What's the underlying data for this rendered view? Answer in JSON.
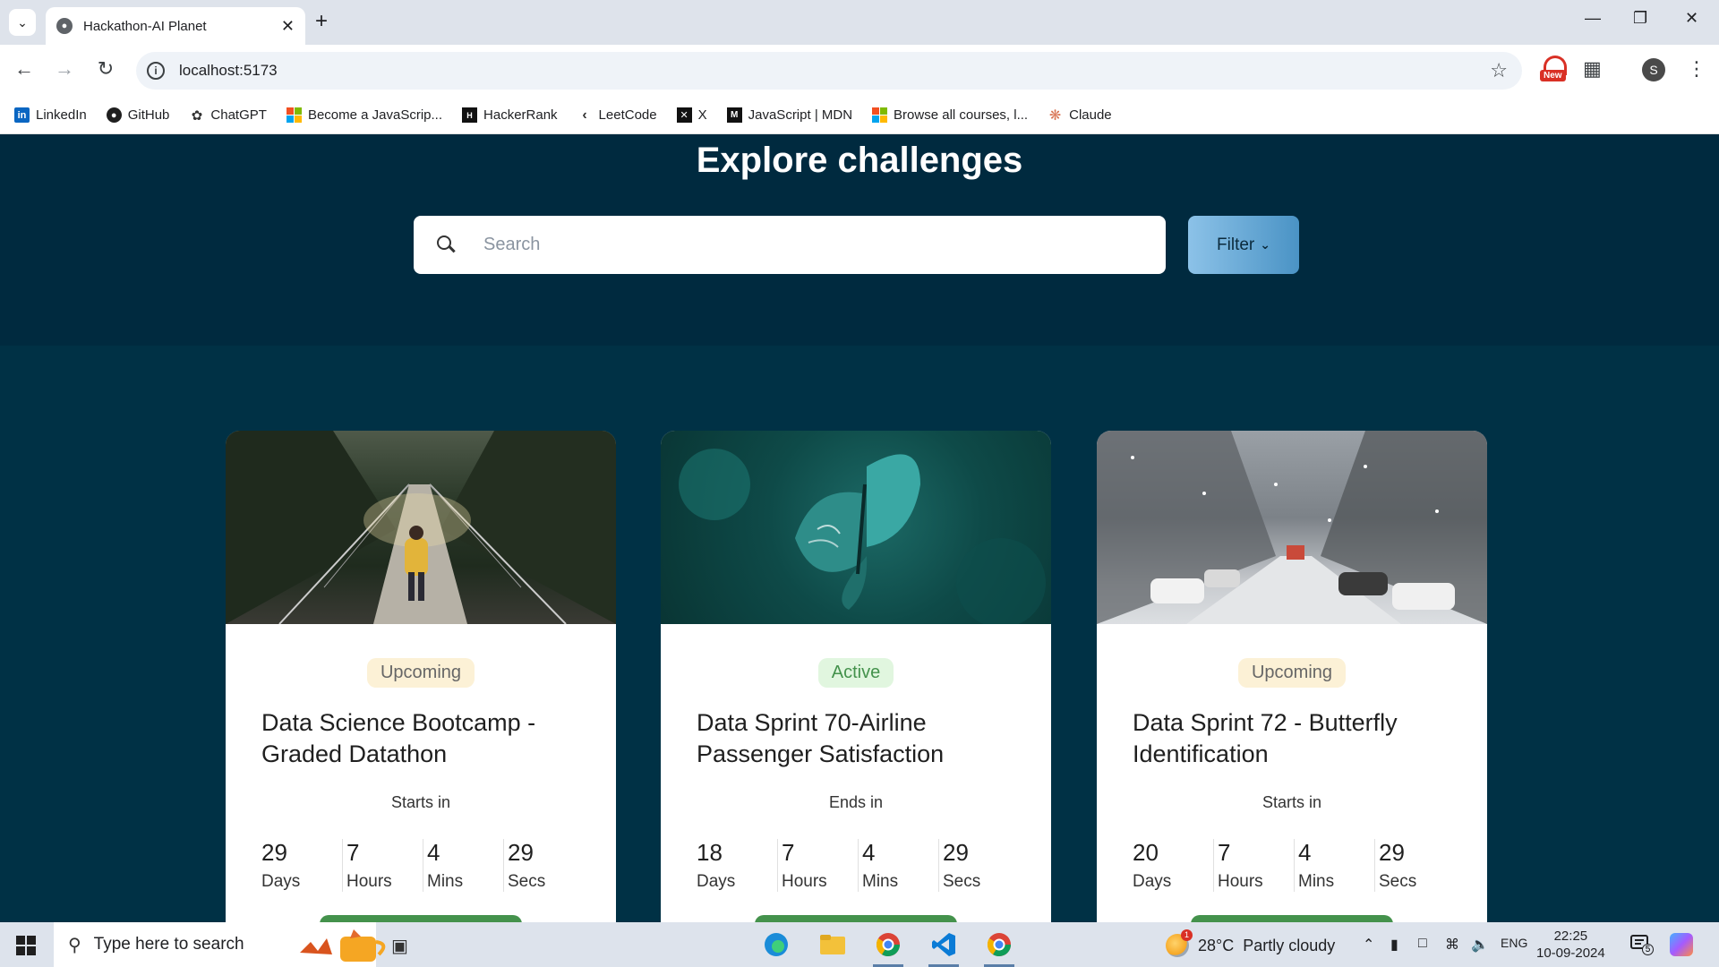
{
  "browser": {
    "tab_title": "Hackathon-AI Planet",
    "url": "localhost:5173",
    "new_badge": "New",
    "profile_initial": "S",
    "bookmarks": [
      {
        "label": "LinkedIn",
        "icon": "linkedin-icon"
      },
      {
        "label": "GitHub",
        "icon": "github-icon"
      },
      {
        "label": "ChatGPT",
        "icon": "chatgpt-icon"
      },
      {
        "label": "Become a JavaScrip...",
        "icon": "microsoft-icon"
      },
      {
        "label": "HackerRank",
        "icon": "hackerrank-icon"
      },
      {
        "label": "LeetCode",
        "icon": "leetcode-icon"
      },
      {
        "label": "X",
        "icon": "x-icon"
      },
      {
        "label": "JavaScript | MDN",
        "icon": "mdn-icon"
      },
      {
        "label": "Browse all courses, l...",
        "icon": "microsoft-icon"
      },
      {
        "label": "Claude",
        "icon": "claude-icon"
      }
    ]
  },
  "page": {
    "title": "Explore challenges",
    "search_placeholder": "Search",
    "filter_label": "Filter"
  },
  "cards": [
    {
      "status": "Upcoming",
      "title": "Data Science Bootcamp - Graded Datathon",
      "timer_label": "Starts in",
      "days": "29",
      "hours": "7",
      "mins": "4",
      "secs": "29",
      "image": "hiker-on-suspension-bridge"
    },
    {
      "status": "Active",
      "title": "Data Sprint 70-Airline Passenger Satisfaction",
      "timer_label": "Ends in",
      "days": "18",
      "hours": "7",
      "mins": "4",
      "secs": "29",
      "image": "teal-butterfly"
    },
    {
      "status": "Upcoming",
      "title": "Data Sprint 72 - Butterfly Identification",
      "timer_label": "Starts in",
      "days": "20",
      "hours": "7",
      "mins": "4",
      "secs": "29",
      "image": "snowy-street"
    }
  ],
  "timer_units": {
    "days": "Days",
    "hours": "Hours",
    "mins": "Mins",
    "secs": "Secs"
  },
  "taskbar": {
    "search_placeholder": "Type here to search",
    "weather_temp": "28°C",
    "weather_desc": "Partly cloudy",
    "weather_alert_count": "1",
    "language": "ENG",
    "time": "22:25",
    "date": "10-09-2024",
    "notification_count": "5"
  },
  "colors": {
    "hero_bg": "#002a3f",
    "content_bg": "#003145",
    "accent_green": "#44924c",
    "upcoming_badge_bg": "#fcf1d6",
    "active_badge_bg": "#e1f6df"
  }
}
